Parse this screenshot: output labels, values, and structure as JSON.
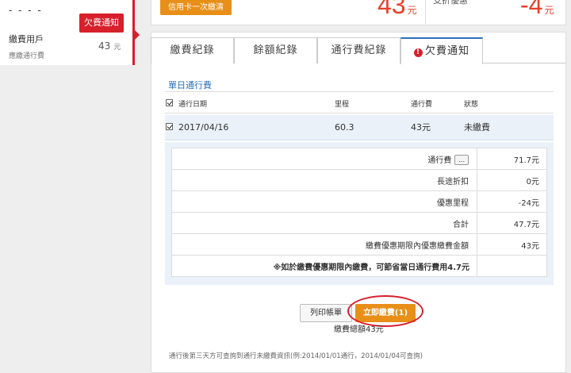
{
  "account": {
    "masked_id": "- - - -",
    "badge": "欠費通知",
    "type": "繳費用戶",
    "amount": "43",
    "amount_unit": "元",
    "desc": "應繳通行費"
  },
  "summary": {
    "credit_card_button": "信用卡一次繳清",
    "amount_value": "43",
    "amount_unit": "元",
    "discount_label_cut": "支折優惠",
    "discount_value": "-4",
    "discount_unit": "元"
  },
  "tabs": [
    {
      "label": "繳費紀錄",
      "active": false
    },
    {
      "label": "餘額紀錄",
      "active": false
    },
    {
      "label": "通行費紀錄",
      "active": false
    },
    {
      "label": "欠費通知",
      "active": true
    }
  ],
  "section_title": "單日通行費",
  "table": {
    "headers": {
      "date": "通行日期",
      "mileage": "里程",
      "fee": "通行費",
      "status": "狀態"
    },
    "rows": [
      {
        "date": "2017/04/16",
        "mileage": "60.3",
        "fee": "43元",
        "status": "未繳費"
      }
    ]
  },
  "detail": {
    "toll_label": "通行費",
    "more_button": "...",
    "toll_value": "71.7元",
    "long_discount_label": "長途折扣",
    "long_discount_value": "0元",
    "preferential_mileage_label": "優惠里程",
    "preferential_mileage_value": "-24元",
    "total_label": "合計",
    "total_value": "47.7元",
    "in_period_label": "繳費優惠期限內優惠繳費金額",
    "in_period_value": "43元",
    "note": "※如於繳費優惠期限內繳費，可節省當日通行費用4.7元"
  },
  "actions": {
    "print": "列印帳單",
    "pay_now": "立即繳費(1)",
    "pay_total": "繳費總額43元"
  },
  "footnote": "通行後第三天方可查詢到通行未繳費資訊(例:2014/01/01通行，2014/01/04可查詢)",
  "colors": {
    "accent_red": "#d7202c",
    "accent_orange": "#e88f18",
    "link_blue": "#2a6fbd"
  }
}
